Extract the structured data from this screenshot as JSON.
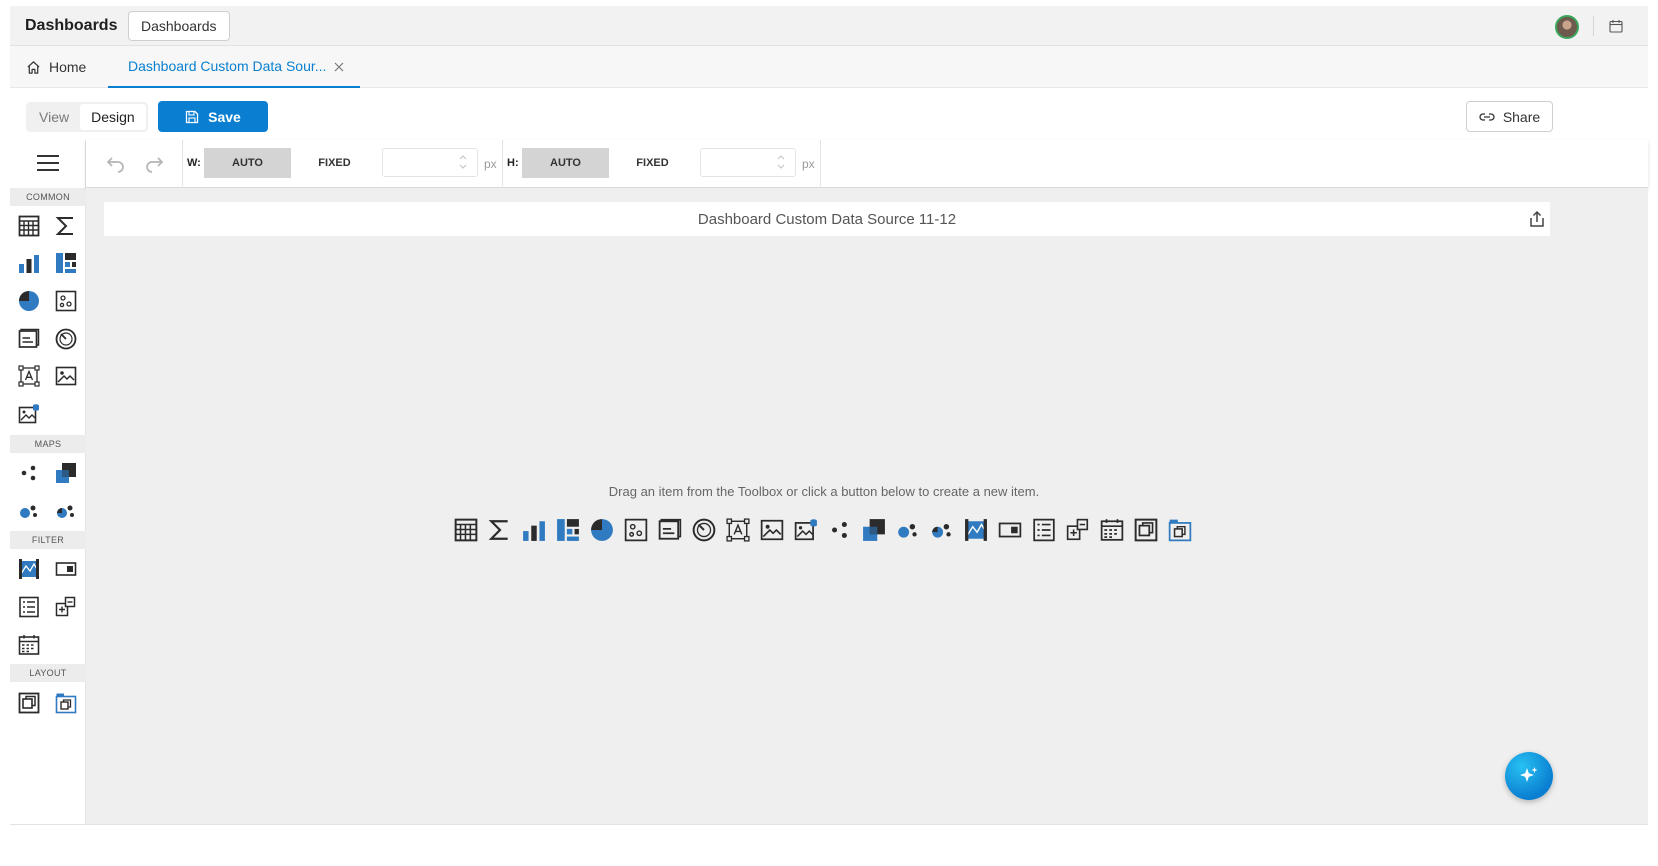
{
  "header": {
    "app_title": "Dashboards",
    "breadcrumb_button": "Dashboards",
    "avatar": "user-avatar",
    "calendar_icon": "calendar-icon"
  },
  "tabs": {
    "home_label": "Home",
    "active_label": "Dashboard Custom Data Sour..."
  },
  "mode": {
    "view_label": "View",
    "design_label": "Design",
    "active": "Design"
  },
  "actions": {
    "save_label": "Save",
    "share_label": "Share"
  },
  "toolbox": {
    "sections": [
      {
        "label": "COMMON",
        "items": [
          "grid-icon",
          "card-sigma-icon",
          "chart-bar-icon",
          "treemap-icon",
          "pie-icon",
          "scatter-icon",
          "text-box-icon",
          "gauge-icon",
          "bound-text-icon",
          "image-icon",
          "bound-image-icon"
        ]
      },
      {
        "label": "MAPS",
        "items": [
          "geo-point-map-icon",
          "choropleth-map-icon",
          "bubble-map-icon",
          "pie-map-icon"
        ]
      },
      {
        "label": "FILTER",
        "items": [
          "range-filter-icon",
          "combo-box-icon",
          "list-box-icon",
          "tree-view-icon",
          "date-filter-icon"
        ]
      },
      {
        "label": "LAYOUT",
        "items": [
          "group-icon",
          "tab-container-icon"
        ]
      }
    ]
  },
  "designer_toolbar": {
    "width_label": "W:",
    "height_label": "H:",
    "auto_label": "AUTO",
    "fixed_label": "FIXED",
    "unit": "px",
    "width_value": "",
    "height_value": "",
    "width_mode": "AUTO",
    "height_mode": "AUTO"
  },
  "canvas": {
    "dashboard_title": "Dashboard Custom Data Source 11-12",
    "empty_hint": "Drag an item from the Toolbox or click a button below to create a new item.",
    "palette_items": [
      "grid-icon",
      "card-sigma-icon",
      "chart-bar-icon",
      "treemap-icon",
      "pie-icon",
      "scatter-icon",
      "text-box-icon",
      "gauge-icon",
      "bound-text-icon",
      "image-icon",
      "bound-image-icon",
      "geo-point-map-icon",
      "choropleth-map-icon",
      "bubble-map-icon",
      "pie-map-icon",
      "range-filter-icon",
      "combo-box-icon",
      "list-box-icon",
      "tree-view-icon",
      "date-filter-icon",
      "group-icon",
      "tab-container-icon"
    ]
  },
  "colors": {
    "accent": "#0a7fd1",
    "icon_dark": "#2b2b2b",
    "icon_blue": "#2f7ac0"
  }
}
